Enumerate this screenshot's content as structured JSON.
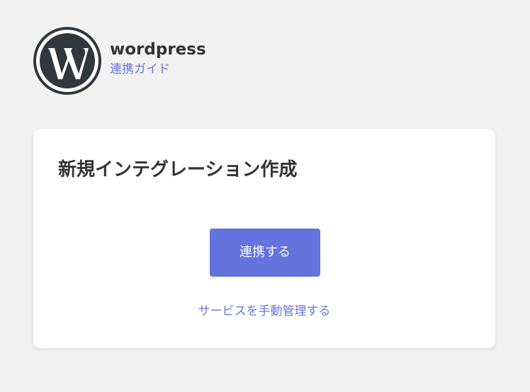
{
  "header": {
    "logo_icon": "wordpress-logo-icon",
    "app_name": "wordpress",
    "guide_link": "連携ガイド"
  },
  "card": {
    "title": "新規インテグレーション作成",
    "connect_button": "連携する",
    "manual_link": "サービスを手動管理する"
  },
  "colors": {
    "accent": "#6473dd",
    "link": "#6b76d8",
    "background": "#f2f2f2",
    "text": "#333333"
  }
}
